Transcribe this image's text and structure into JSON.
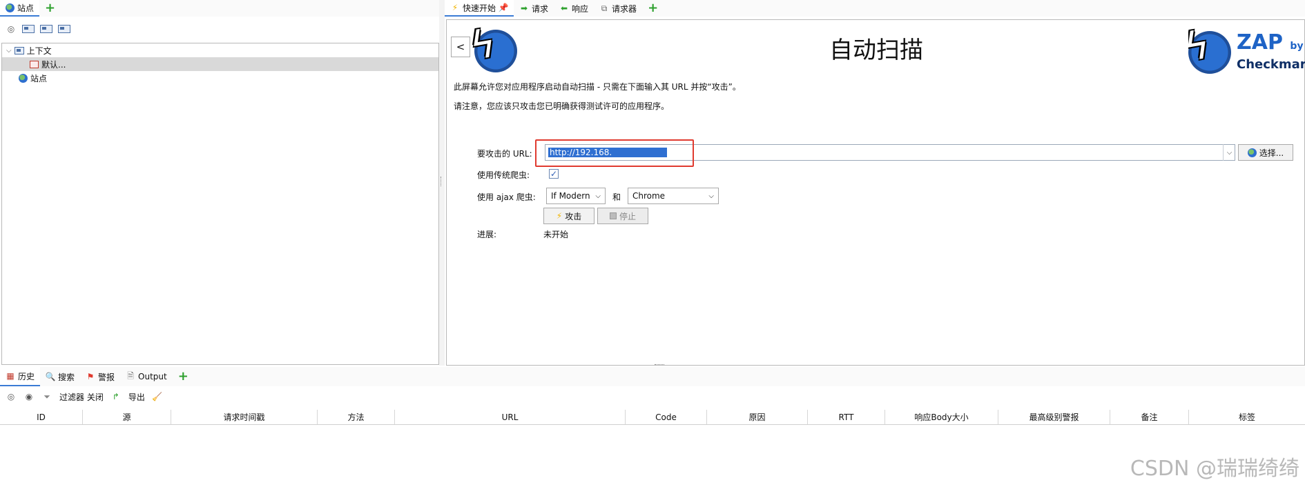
{
  "left_panel": {
    "tab_label": "站点",
    "tree": [
      {
        "label": "上下文",
        "expanded": true
      },
      {
        "label": "默认...",
        "selected": true
      },
      {
        "label": "站点"
      }
    ]
  },
  "right_panel": {
    "tabs": [
      "快速开始",
      "请求",
      "响应",
      "请求器"
    ],
    "title": "自动扫描",
    "back_label": "<",
    "desc1": "此屏幕允许您对应用程序启动自动扫描 - 只需在下面输入其 URL 并按“攻击”。",
    "desc2": "请注意，您应该只攻击您已明确获得测试许可的应用程序。",
    "form": {
      "url_label": "要攻击的 URL:",
      "url_value": "http://192.168.",
      "select_label": "选择...",
      "traditional_label": "使用传统爬虫:",
      "traditional_checked": true,
      "ajax_label": "使用 ajax 爬虫:",
      "ajax_option": "If Modern",
      "and_label": "和",
      "browser_option": "Chrome",
      "attack_label": "攻击",
      "stop_label": "停止",
      "progress_label": "进展:",
      "progress_value": "未开始"
    },
    "logo": {
      "name": "ZAP",
      "by": "by",
      "company": "Checkmarx"
    }
  },
  "bottom_panel": {
    "tabs": [
      "历史",
      "搜索",
      "警报",
      "Output"
    ],
    "toolbar": {
      "filter_label": "过滤器 关闭",
      "export_label": "导出"
    },
    "columns": [
      "ID",
      "源",
      "请求时间戳",
      "方法",
      "URL",
      "Code",
      "原因",
      "RTT",
      "响应Body大小",
      "最高级别警报",
      "备注",
      "标签"
    ]
  },
  "watermark": "CSDN @瑞瑞绮绮",
  "colors": {
    "accent": "#3a7bd5",
    "highlight_box": "#e03a2f",
    "url_selection": "#2f6fd1"
  }
}
